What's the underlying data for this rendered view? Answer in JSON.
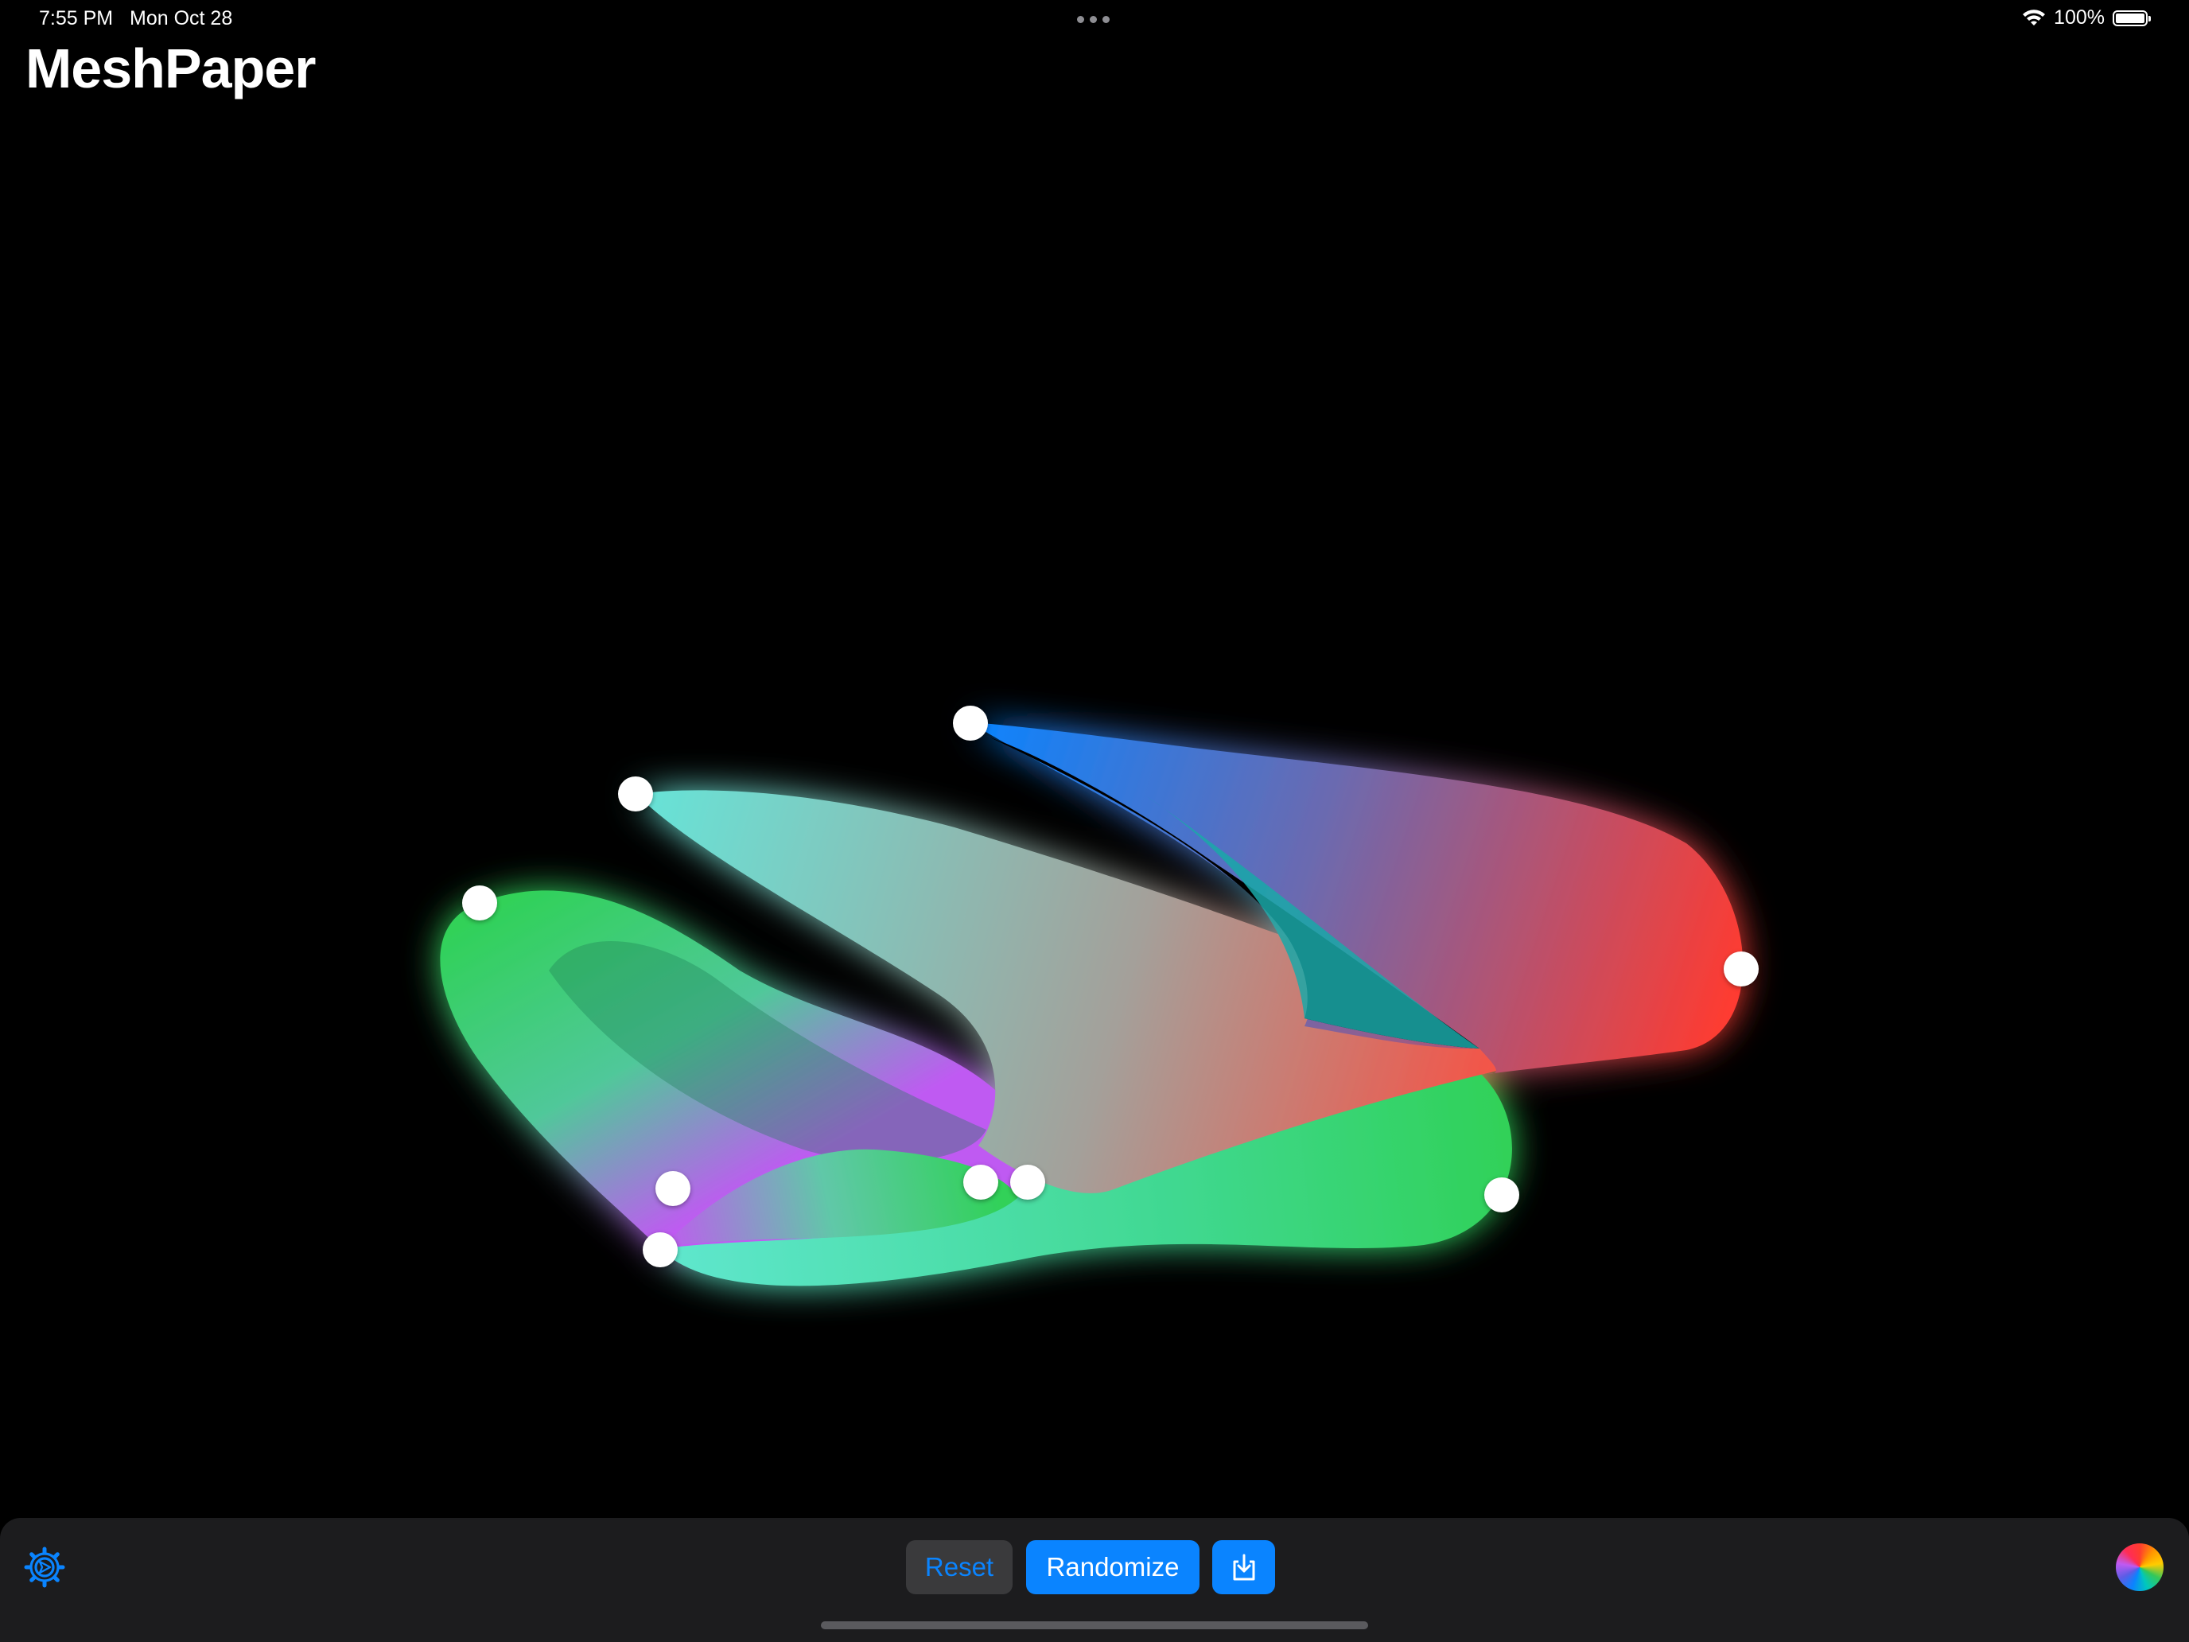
{
  "status_bar": {
    "time": "7:55 PM",
    "date": "Mon Oct 28",
    "battery": "100%",
    "icons": [
      "wifi-icon",
      "battery-icon"
    ]
  },
  "app": {
    "title": "MeshPaper"
  },
  "mesh": {
    "colors": {
      "blue": "#0a84ff",
      "red": "#ff3b30",
      "green": "#30d158",
      "teal": "#66e4d8",
      "purple": "#bf5af2"
    },
    "control_point_count": 9
  },
  "toolbar": {
    "settings_icon": "gear-icon",
    "reset_label": "Reset",
    "randomize_label": "Randomize",
    "export_icon": "export-icon",
    "color_picker_icon": "color-wheel-icon",
    "accent": "#0a84ff"
  }
}
